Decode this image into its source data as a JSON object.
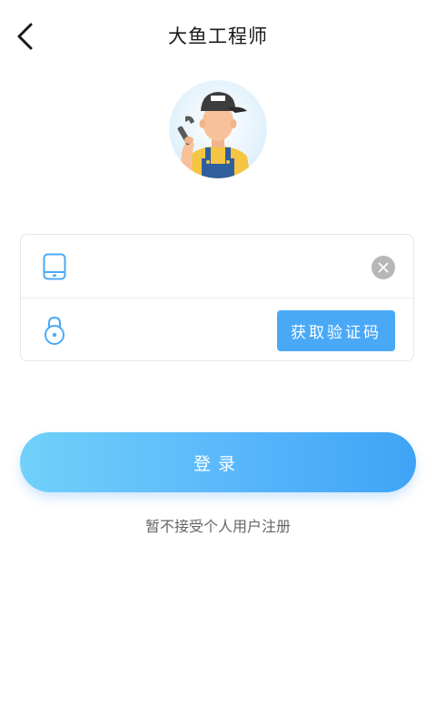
{
  "header": {
    "title": "大鱼工程师",
    "back_icon": "chevron-left-icon"
  },
  "avatar": {
    "icon": "engineer-avatar-icon"
  },
  "form": {
    "phone": {
      "icon": "phone-icon",
      "value": "",
      "placeholder": "",
      "clear_icon": "clear-icon"
    },
    "code": {
      "icon": "lock-icon",
      "value": "",
      "placeholder": "",
      "get_code_label": "获取验证码"
    }
  },
  "actions": {
    "login_label": "登录",
    "register_link": "暂不接受个人用户注册"
  },
  "colors": {
    "accent": "#4aa9f7",
    "gradient_start": "#72d0fb",
    "gradient_end": "#3fa4f6",
    "clear_gray": "#b7b7b7"
  }
}
